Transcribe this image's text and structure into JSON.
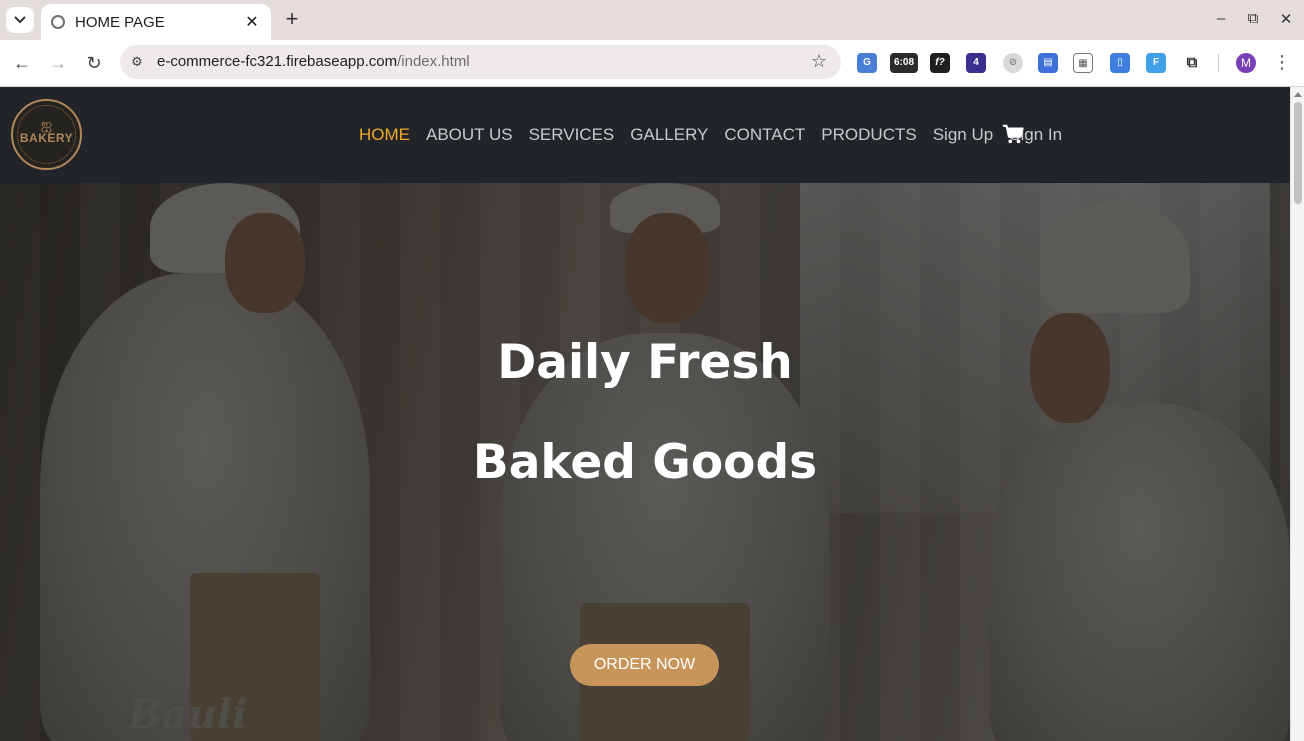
{
  "browser": {
    "tab_title": "HOME PAGE",
    "url_host": "e-commerce-fc321.firebaseapp.com",
    "url_path": "/index.html",
    "extension_timer": "6:08",
    "extension_badge": "4",
    "profile_initial": "M"
  },
  "site": {
    "logo_text": "BAKERY",
    "nav": [
      "HOME",
      "ABOUT US",
      "SERVICES",
      "GALLERY",
      "CONTACT",
      "PRODUCTS",
      "Sign Up",
      "Sign In"
    ],
    "active_nav": "HOME",
    "hero_line1": "Daily Fresh",
    "hero_line2": "Baked Goods",
    "cta_label": "ORDER NOW",
    "hero_brand_text": "Bauli"
  },
  "colors": {
    "header_bg": "#212529",
    "active_nav": "#f0a928",
    "cta_bg": "#c7955a"
  }
}
